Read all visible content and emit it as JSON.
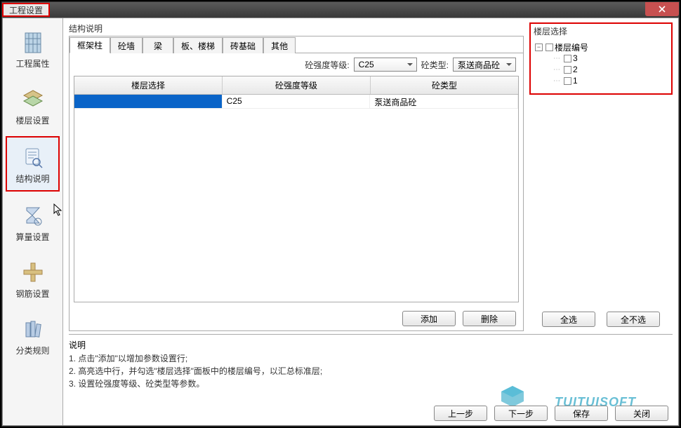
{
  "window": {
    "title": "工程设置"
  },
  "sidebar": {
    "items": [
      {
        "label": "工程属性"
      },
      {
        "label": "楼层设置"
      },
      {
        "label": "结构说明"
      },
      {
        "label": "算量设置"
      },
      {
        "label": "钢筋设置"
      },
      {
        "label": "分类规则"
      }
    ]
  },
  "struct": {
    "group_label": "结构说明",
    "tabs": [
      "框架柱",
      "砼墙",
      "梁",
      "板、楼梯",
      "砖基础",
      "其他"
    ],
    "filter": {
      "strength_label": "砼强度等级:",
      "strength_value": "C25",
      "type_label": "砼类型:",
      "type_value": "泵送商品砼"
    },
    "grid": {
      "headers": [
        "楼层选择",
        "砼强度等级",
        "砼类型"
      ],
      "rows": [
        {
          "floor": "",
          "strength": "C25",
          "type": "泵送商品砼"
        }
      ]
    },
    "buttons": {
      "add": "添加",
      "delete": "删除"
    }
  },
  "floor_panel": {
    "title": "楼层选择",
    "root": "楼层编号",
    "children": [
      "3",
      "2",
      "1"
    ],
    "select_all": "全选",
    "select_none": "全不选"
  },
  "desc": {
    "title": "说明",
    "lines": [
      "1. 点击\"添加\"以增加参数设置行;",
      "2. 高亮选中行，并勾选\"楼层选择\"面板中的楼层编号，以汇总标准层;",
      "3. 设置砼强度等级、砼类型等参数。"
    ]
  },
  "footer": {
    "prev": "上一步",
    "next": "下一步",
    "save": "保存",
    "close": "关闭"
  },
  "watermark": "TUITUISOFT"
}
